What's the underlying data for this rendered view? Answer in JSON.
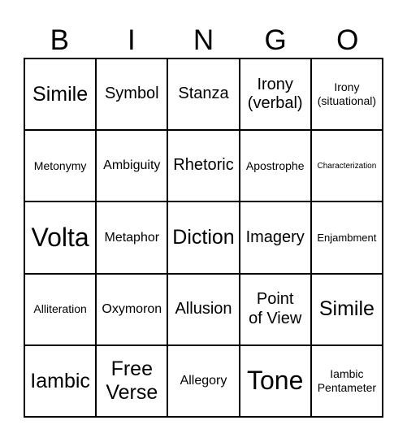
{
  "header": {
    "letters": [
      "B",
      "I",
      "N",
      "G",
      "O"
    ]
  },
  "board": {
    "rows": [
      [
        {
          "text": "Simile",
          "size": "l"
        },
        {
          "text": "Symbol",
          "size": "m"
        },
        {
          "text": "Stanza",
          "size": "m"
        },
        {
          "text": "Irony\n(verbal)",
          "size": "m"
        },
        {
          "text": "Irony\n(situational)",
          "size": "xs"
        }
      ],
      [
        {
          "text": "Metonymy",
          "size": "xs"
        },
        {
          "text": "Ambiguity",
          "size": "s"
        },
        {
          "text": "Rhetoric",
          "size": "m"
        },
        {
          "text": "Apostrophe",
          "size": "xs"
        },
        {
          "text": "Characterization",
          "size": "tiny"
        }
      ],
      [
        {
          "text": "Volta",
          "size": "xl"
        },
        {
          "text": "Metaphor",
          "size": "s"
        },
        {
          "text": "Diction",
          "size": "l"
        },
        {
          "text": "Imagery",
          "size": "m"
        },
        {
          "text": "Enjambment",
          "size": "xxs"
        }
      ],
      [
        {
          "text": "Alliteration",
          "size": "xs"
        },
        {
          "text": "Oxymoron",
          "size": "s"
        },
        {
          "text": "Allusion",
          "size": "m"
        },
        {
          "text": "Point\nof View",
          "size": "m"
        },
        {
          "text": "Simile",
          "size": "l"
        }
      ],
      [
        {
          "text": "Iambic",
          "size": "l"
        },
        {
          "text": "Free\nVerse",
          "size": "l"
        },
        {
          "text": "Allegory",
          "size": "s"
        },
        {
          "text": "Tone",
          "size": "xl"
        },
        {
          "text": "Iambic\nPentameter",
          "size": "xs"
        }
      ]
    ]
  }
}
